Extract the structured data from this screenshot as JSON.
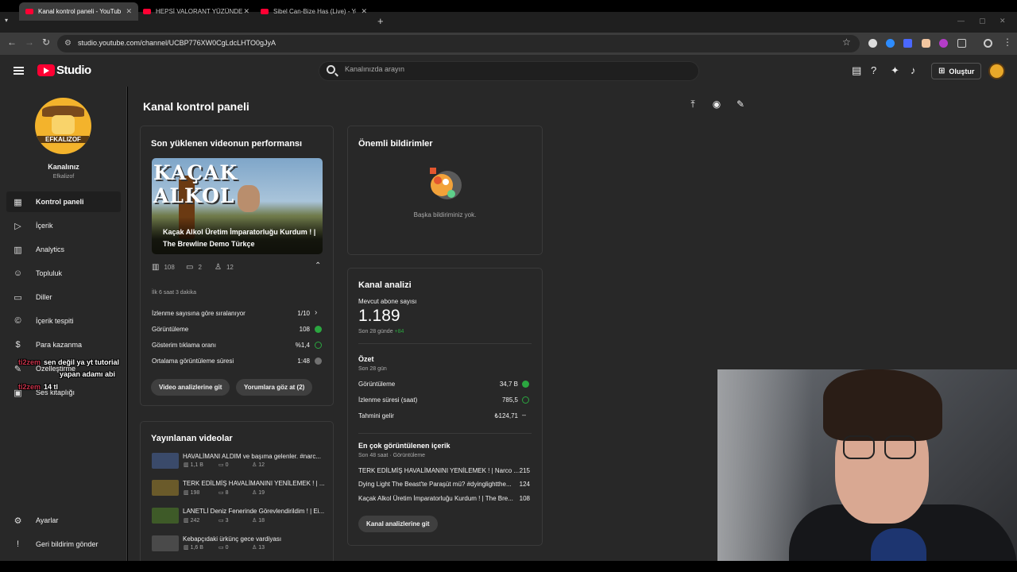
{
  "browser": {
    "tabs": [
      {
        "title": "Kanal kontrol paneli - YouTube"
      },
      {
        "title": "HEPSİ VALORANT YÜZÜNDEN"
      },
      {
        "title": "Sibel Can-Bize Has (Live) - You"
      }
    ],
    "url": "studio.youtube.com/channel/UCBP776XW0CgLdcLHTO0gJyA"
  },
  "header": {
    "logo_text": "Studio",
    "search_placeholder": "Kanalınızda arayın",
    "create_label": "Oluştur"
  },
  "sidebar": {
    "avatar_text": "EFKALIZOF",
    "channel_title": "Kanalınız",
    "channel_name": "Efkalizof",
    "items": [
      {
        "label": "Kontrol paneli",
        "icon": "dashboard-icon"
      },
      {
        "label": "İçerik",
        "icon": "content-icon"
      },
      {
        "label": "Analytics",
        "icon": "analytics-icon"
      },
      {
        "label": "Topluluk",
        "icon": "community-icon"
      },
      {
        "label": "Diller",
        "icon": "subtitles-icon"
      },
      {
        "label": "İçerik tespiti",
        "icon": "copyright-icon"
      },
      {
        "label": "Para kazanma",
        "icon": "dollar-icon"
      },
      {
        "label": "Özelleştirme",
        "icon": "customize-icon"
      },
      {
        "label": "Ses kitaplığı",
        "icon": "audio-library-icon"
      }
    ],
    "settings_label": "Ayarlar",
    "feedback_label": "Geri bildirim gönder"
  },
  "overlay_chat": [
    {
      "user": "ti2zem",
      "message": "sen değil ya yt tutorial"
    },
    {
      "user": "",
      "message": "yapan adamı abi"
    },
    {
      "user": "ti2zem",
      "message": "14 tl"
    }
  ],
  "main": {
    "page_title": "Kanal kontrol paneli",
    "latest_video": {
      "card_title": "Son yüklenen videonun performansı",
      "thumb_text": "KAÇAK ALKOL",
      "title": "Kaçak Alkol Üretim İmparatorluğu Kurdum ! | The Brewline Demo Türkçe",
      "views": "108",
      "comments": "2",
      "likes": "12",
      "period": "İlk 6 saat 3 dakika",
      "rows": [
        {
          "label": "İzlenme sayısına göre sıralanıyor",
          "value": "1/10"
        },
        {
          "label": "Görüntüleme",
          "value": "108"
        },
        {
          "label": "Gösterim tıklama oranı",
          "value": "%1,4"
        },
        {
          "label": "Ortalama görüntüleme süresi",
          "value": "1:48"
        }
      ],
      "btn_analytics": "Video analizlerine git",
      "btn_comments": "Yorumlara göz at (2)"
    },
    "published": {
      "card_title": "Yayınlanan videolar",
      "videos": [
        {
          "title": "HAVALİMANI ALDIM ve başıma gelenler. #narc...",
          "views": "1,1 B",
          "comments": "0",
          "likes": "12"
        },
        {
          "title": "TERK EDİLMİŞ HAVALİMANINI YENİLEMEK ! | ...",
          "views": "198",
          "comments": "8",
          "likes": "19"
        },
        {
          "title": "LANETLİ Deniz Fenerinde Görevlendirildim ! | Ei...",
          "views": "242",
          "comments": "3",
          "likes": "18"
        },
        {
          "title": "Kebapçıdaki ürkünç gece vardiyası",
          "views": "1,6 B",
          "comments": "0",
          "likes": "13"
        }
      ]
    },
    "notifications": {
      "card_title": "Önemli bildirimler",
      "empty_text": "Başka bildiriminiz yok."
    },
    "channel_analytics": {
      "card_title": "Kanal analizi",
      "subs_label": "Mevcut abone sayısı",
      "subs_value": "1.189",
      "subs_period": "Son 28 günde",
      "subs_delta": "+84",
      "summary_title": "Özet",
      "summary_period": "Son 28 gün",
      "summary_rows": [
        {
          "label": "Görüntüleme",
          "value": "34,7 B"
        },
        {
          "label": "İzlenme süresi (saat)",
          "value": "785,5"
        },
        {
          "label": "Tahmini gelir",
          "value": "₺124,71"
        }
      ],
      "top_title": "En çok görüntülenen içerik",
      "top_period": "Son 48 saat · Görüntüleme",
      "top_rows": [
        {
          "title": "TERK EDİLMİŞ HAVALİMANINI YENİLEMEK ! | Narco ...",
          "value": "215"
        },
        {
          "title": "Dying Light The Beast'te Paraşüt mü? #dyinglightthe...",
          "value": "124"
        },
        {
          "title": "Kaçak Alkol Üretim İmparatorluğu Kurdum ! | The Bre...",
          "value": "108"
        }
      ],
      "btn_channel_analytics": "Kanal analizlerine git"
    }
  },
  "colors": {
    "accent_red": "#ff0033",
    "positive_green": "#2ba640",
    "background": "#282828"
  }
}
